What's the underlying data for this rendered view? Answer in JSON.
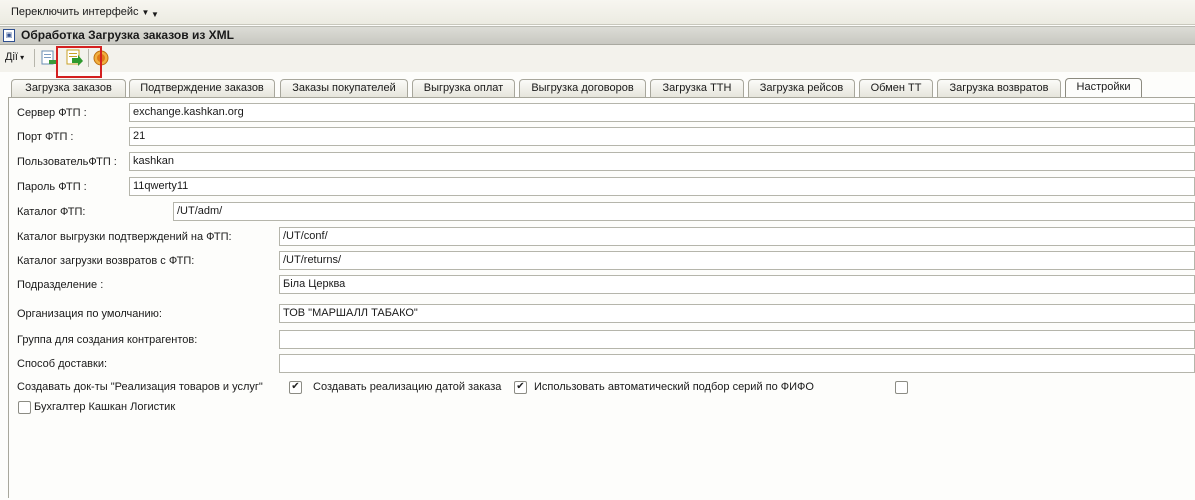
{
  "topbar": {
    "menu_label": "Переключить интерфейс"
  },
  "window": {
    "title": "Обработка  Загрузка заказов из XML"
  },
  "toolbar": {
    "actions_label": "Дії"
  },
  "tabs": [
    {
      "label": "Загрузка заказов"
    },
    {
      "label": "Подтверждение заказов"
    },
    {
      "label": "Заказы покупателей"
    },
    {
      "label": "Выгрузка оплат"
    },
    {
      "label": "Выгрузка договоров"
    },
    {
      "label": "Загрузка ТТН"
    },
    {
      "label": "Загрузка рейсов"
    },
    {
      "label": "Обмен ТТ"
    },
    {
      "label": "Загрузка возвратов"
    },
    {
      "label": "Настройки"
    }
  ],
  "settings": {
    "ftp_server": {
      "label": "Сервер ФТП  :",
      "value": "exchange.kashkan.org"
    },
    "ftp_port": {
      "label": "Порт ФТП  :",
      "value": "21"
    },
    "ftp_user": {
      "label": "ПользовательФТП  :",
      "value": "kashkan"
    },
    "ftp_password": {
      "label": "Пароль ФТП  :",
      "value": "11qwerty11"
    },
    "ftp_catalog": {
      "label": "Каталог ФТП:",
      "value": "/UT/adm/"
    },
    "confirm_catalog": {
      "label": "Каталог выгрузки подтверждений на ФТП:",
      "value": "/UT/conf/"
    },
    "returns_catalog": {
      "label": "Каталог загрузки возвратов с ФТП:",
      "value": "/UT/returns/"
    },
    "department": {
      "label": "Подразделение :",
      "value": "Біла Церква"
    },
    "default_org": {
      "label": "Организация по умолчанию:",
      "value": "ТОВ \"МАРШАЛЛ ТАБАКО\""
    },
    "counterparty_group": {
      "label": "Группа для создания контрагентов:",
      "value": ""
    },
    "delivery_method": {
      "label": "Способ доставки:",
      "value": ""
    },
    "create_docs": {
      "label": "Создавать док-ты \"Реализация товаров и услуг\"",
      "checked": true
    },
    "create_by_order_date": {
      "label": "Создавать реализацию датой заказа",
      "checked": true
    },
    "fifo_series": {
      "label": "Использовать автоматический подбор серий по ФИФО",
      "checked": false
    },
    "accountant": {
      "label": "Бухгалтер Кашкан Логистик",
      "checked": false
    }
  },
  "colors": {
    "highlight": "#d42020",
    "title_bar": "#c8c8c1"
  }
}
